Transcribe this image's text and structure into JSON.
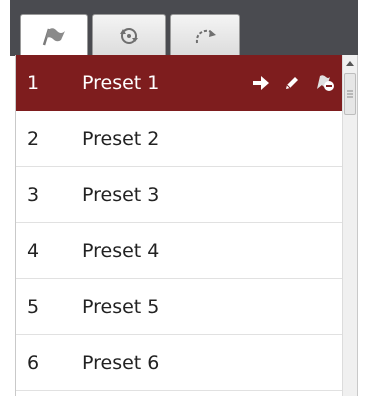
{
  "tabs": [
    {
      "icon": "flag-icon",
      "active": true
    },
    {
      "icon": "patrol-cycle-icon",
      "active": false
    },
    {
      "icon": "redo-arrow-icon",
      "active": false
    }
  ],
  "presets": [
    {
      "number": "1",
      "name": "Preset 1",
      "selected": true
    },
    {
      "number": "2",
      "name": "Preset 2",
      "selected": false
    },
    {
      "number": "3",
      "name": "Preset 3",
      "selected": false
    },
    {
      "number": "4",
      "name": "Preset 4",
      "selected": false
    },
    {
      "number": "5",
      "name": "Preset 5",
      "selected": false
    },
    {
      "number": "6",
      "name": "Preset 6",
      "selected": false
    }
  ],
  "row_actions": [
    "go-to-arrow-icon",
    "pencil-edit-icon",
    "delete-preset-icon"
  ],
  "colors": {
    "selected_row": "#7e1d1e",
    "tabbar": "#4a4b50"
  }
}
